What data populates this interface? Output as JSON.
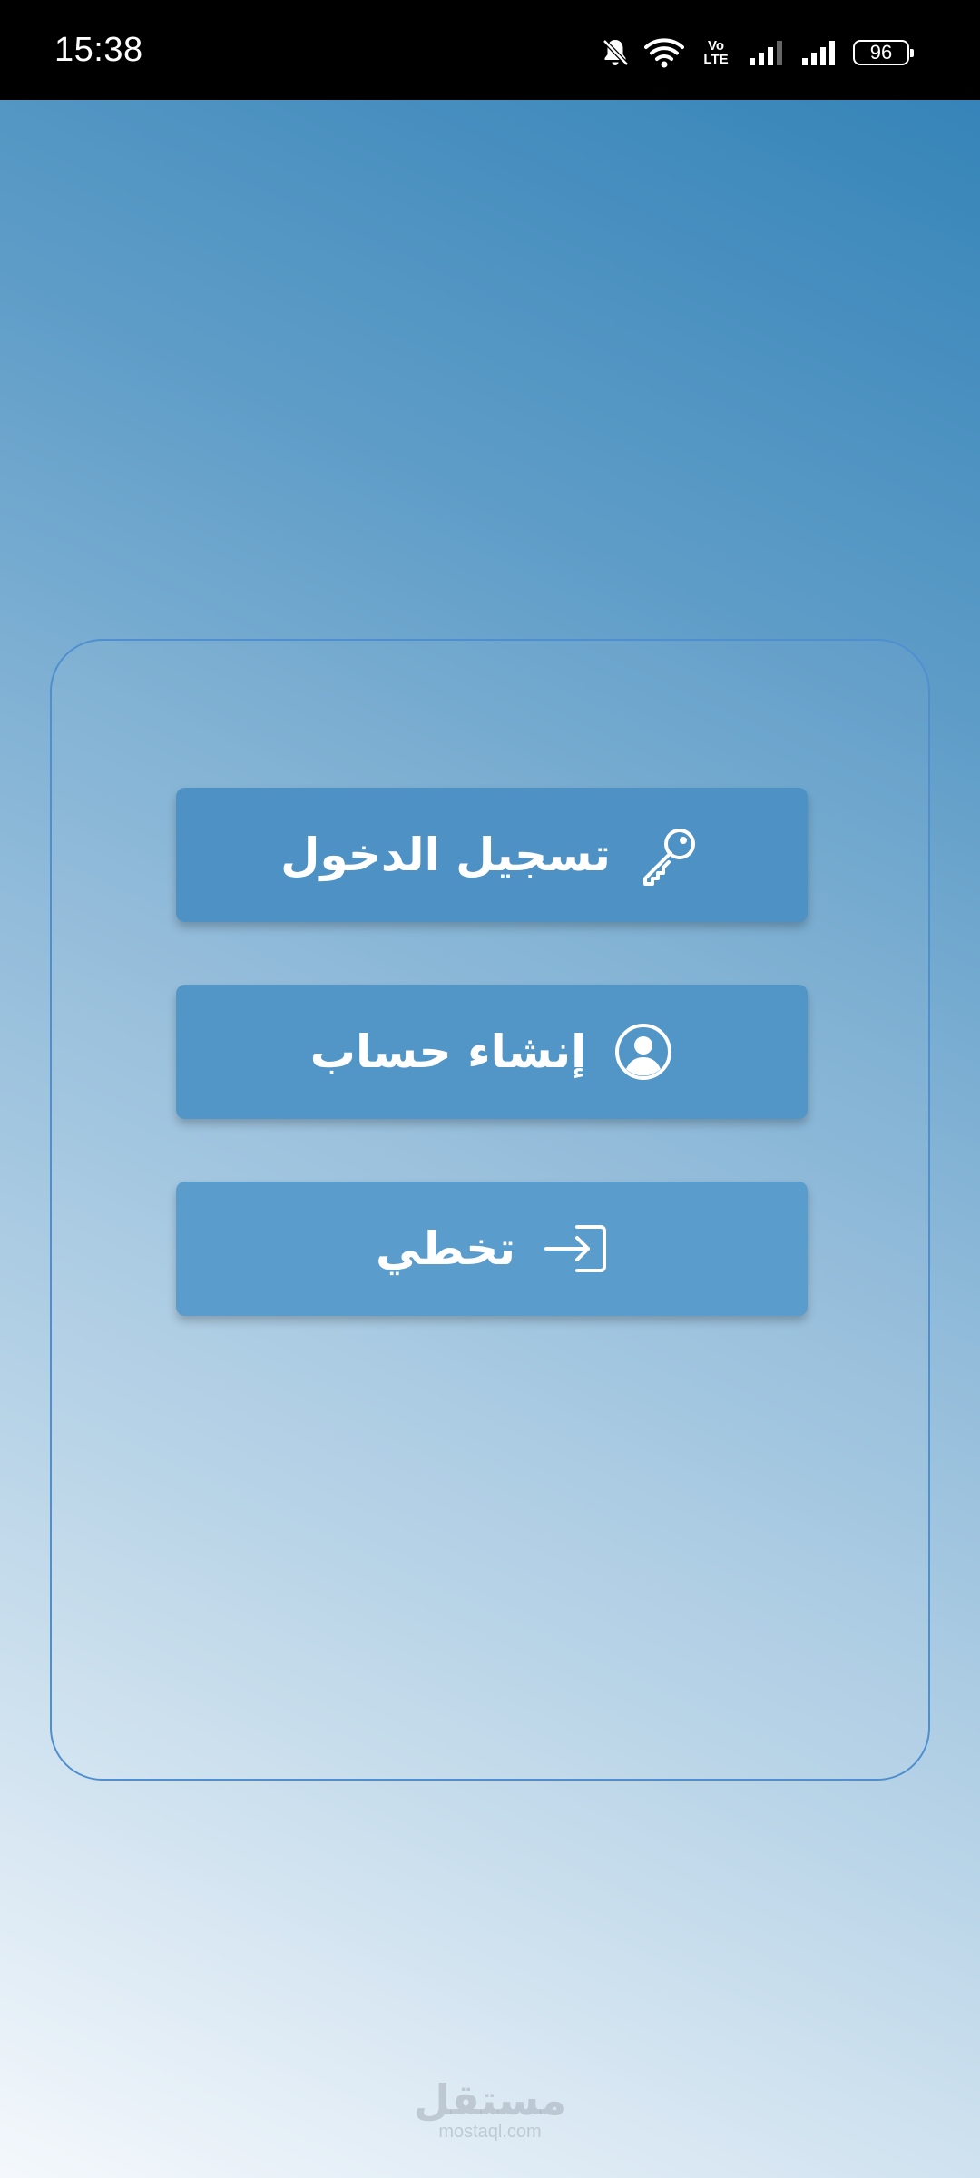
{
  "status_bar": {
    "time": "15:38",
    "volte_top": "Vo",
    "volte_bottom": "LTE",
    "battery": "96",
    "icons": [
      "mute-bell-icon",
      "wifi-icon",
      "volte-icon",
      "signal-icon",
      "signal-icon",
      "battery-icon"
    ]
  },
  "actions": {
    "login": {
      "label": "تسجيل الدخول",
      "icon": "key-icon"
    },
    "register": {
      "label": "إنشاء حساب",
      "icon": "user-circle-icon"
    },
    "skip": {
      "label": "تخطي",
      "icon": "sign-in-icon"
    }
  },
  "watermark": {
    "arabic": "مستقل",
    "latin": "mostaql.com"
  },
  "colors": {
    "button": "#5095c6",
    "card_border": "#4f8fd0",
    "status_bar": "#000000"
  }
}
